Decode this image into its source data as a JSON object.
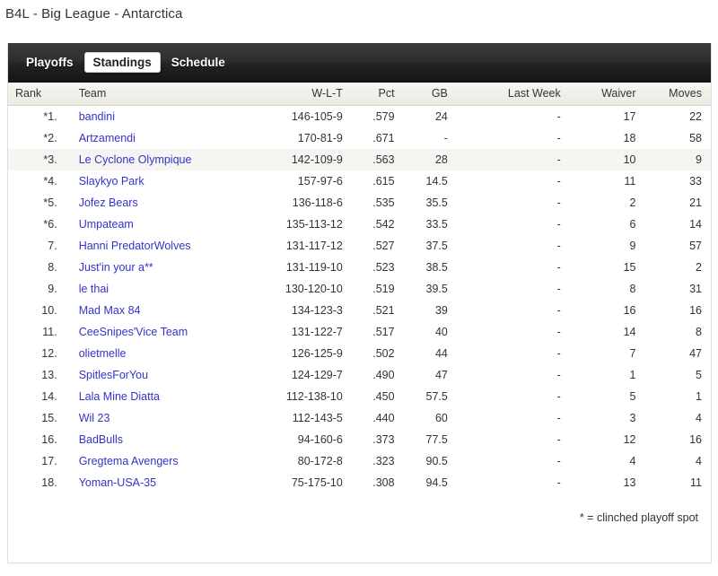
{
  "page_title": "B4L - Big League - Antarctica",
  "nav": {
    "tabs": [
      {
        "label": "Playoffs",
        "active": false
      },
      {
        "label": "Standings",
        "active": true
      },
      {
        "label": "Schedule",
        "active": false
      }
    ]
  },
  "table": {
    "columns": [
      "Rank",
      "Team",
      "W-L-T",
      "Pct",
      "GB",
      "Last Week",
      "Waiver",
      "Moves"
    ],
    "rows": [
      {
        "rank": "*1.",
        "team": "bandini",
        "wlt": "146-105-9",
        "pct": ".579",
        "gb": "24",
        "last_week": "-",
        "waiver": "17",
        "moves": "22",
        "highlight": false
      },
      {
        "rank": "*2.",
        "team": "Artzamendi",
        "wlt": "170-81-9",
        "pct": ".671",
        "gb": "-",
        "last_week": "-",
        "waiver": "18",
        "moves": "58",
        "highlight": false
      },
      {
        "rank": "*3.",
        "team": "Le Cyclone Olympique",
        "wlt": "142-109-9",
        "pct": ".563",
        "gb": "28",
        "last_week": "-",
        "waiver": "10",
        "moves": "9",
        "highlight": true
      },
      {
        "rank": "*4.",
        "team": "Slaykyo Park",
        "wlt": "157-97-6",
        "pct": ".615",
        "gb": "14.5",
        "last_week": "-",
        "waiver": "11",
        "moves": "33",
        "highlight": false
      },
      {
        "rank": "*5.",
        "team": "Jofez Bears",
        "wlt": "136-118-6",
        "pct": ".535",
        "gb": "35.5",
        "last_week": "-",
        "waiver": "2",
        "moves": "21",
        "highlight": false
      },
      {
        "rank": "*6.",
        "team": "Umpateam",
        "wlt": "135-113-12",
        "pct": ".542",
        "gb": "33.5",
        "last_week": "-",
        "waiver": "6",
        "moves": "14",
        "highlight": false
      },
      {
        "rank": "7.",
        "team": "Hanni PredatorWolves",
        "wlt": "131-117-12",
        "pct": ".527",
        "gb": "37.5",
        "last_week": "-",
        "waiver": "9",
        "moves": "57",
        "highlight": false
      },
      {
        "rank": "8.",
        "team": "Just'in your a**",
        "wlt": "131-119-10",
        "pct": ".523",
        "gb": "38.5",
        "last_week": "-",
        "waiver": "15",
        "moves": "2",
        "highlight": false
      },
      {
        "rank": "9.",
        "team": "le thai",
        "wlt": "130-120-10",
        "pct": ".519",
        "gb": "39.5",
        "last_week": "-",
        "waiver": "8",
        "moves": "31",
        "highlight": false
      },
      {
        "rank": "10.",
        "team": "Mad Max 84",
        "wlt": "134-123-3",
        "pct": ".521",
        "gb": "39",
        "last_week": "-",
        "waiver": "16",
        "moves": "16",
        "highlight": false
      },
      {
        "rank": "11.",
        "team": "CeeSnipes'Vice Team",
        "wlt": "131-122-7",
        "pct": ".517",
        "gb": "40",
        "last_week": "-",
        "waiver": "14",
        "moves": "8",
        "highlight": false
      },
      {
        "rank": "12.",
        "team": "olietmelle",
        "wlt": "126-125-9",
        "pct": ".502",
        "gb": "44",
        "last_week": "-",
        "waiver": "7",
        "moves": "47",
        "highlight": false
      },
      {
        "rank": "13.",
        "team": "SpitlesForYou",
        "wlt": "124-129-7",
        "pct": ".490",
        "gb": "47",
        "last_week": "-",
        "waiver": "1",
        "moves": "5",
        "highlight": false
      },
      {
        "rank": "14.",
        "team": "Lala Mine Diatta",
        "wlt": "112-138-10",
        "pct": ".450",
        "gb": "57.5",
        "last_week": "-",
        "waiver": "5",
        "moves": "1",
        "highlight": false
      },
      {
        "rank": "15.",
        "team": "Wil 23",
        "wlt": "112-143-5",
        "pct": ".440",
        "gb": "60",
        "last_week": "-",
        "waiver": "3",
        "moves": "4",
        "highlight": false
      },
      {
        "rank": "16.",
        "team": "BadBulls",
        "wlt": "94-160-6",
        "pct": ".373",
        "gb": "77.5",
        "last_week": "-",
        "waiver": "12",
        "moves": "16",
        "highlight": false
      },
      {
        "rank": "17.",
        "team": "Gregtema Avengers",
        "wlt": "80-172-8",
        "pct": ".323",
        "gb": "90.5",
        "last_week": "-",
        "waiver": "4",
        "moves": "4",
        "highlight": false
      },
      {
        "rank": "18.",
        "team": "Yoman-USA-35",
        "wlt": "75-175-10",
        "pct": ".308",
        "gb": "94.5",
        "last_week": "-",
        "waiver": "13",
        "moves": "11",
        "highlight": false
      }
    ]
  },
  "footnote": "* = clinched playoff spot",
  "colors": {
    "link": "#3333CC",
    "nav_background": "#2B2B2B",
    "header_background": "#F1F0EA",
    "row_highlight": "#F6F5F2"
  }
}
